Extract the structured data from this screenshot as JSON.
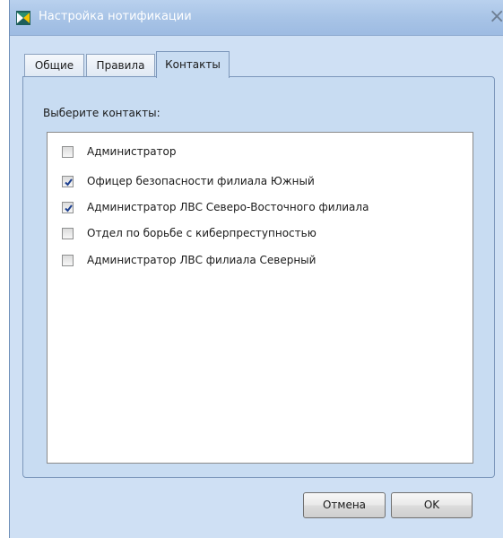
{
  "window": {
    "title": "Настройка нотификации",
    "close_glyph": "×"
  },
  "tabs": [
    {
      "label": "Общие",
      "active": false
    },
    {
      "label": "Правила",
      "active": false
    },
    {
      "label": "Контакты",
      "active": true
    }
  ],
  "contacts_panel": {
    "prompt": "Выберите контакты:",
    "items": [
      {
        "label": "Администратор",
        "checked": false
      },
      {
        "label": "Офицер безопасности филиала Южный",
        "checked": true
      },
      {
        "label": "Администратор ЛВС Северо-Восточного филиала",
        "checked": true
      },
      {
        "label": "Отдел по борьбе с киберпреступностью",
        "checked": false
      },
      {
        "label": "Администратор ЛВС филиала Северный",
        "checked": false
      }
    ]
  },
  "buttons": {
    "cancel": "Отмена",
    "ok": "OK"
  },
  "icons": {
    "app": "app-logo-icon",
    "close": "close-icon",
    "check": "checkmark-icon"
  },
  "colors": {
    "window_background": "#cfe0f4",
    "title_bar": "#a7c3e6",
    "title_text": "#ffffff",
    "panel_background": "#c8dcf2",
    "check_mark": "#1c3f8f"
  }
}
